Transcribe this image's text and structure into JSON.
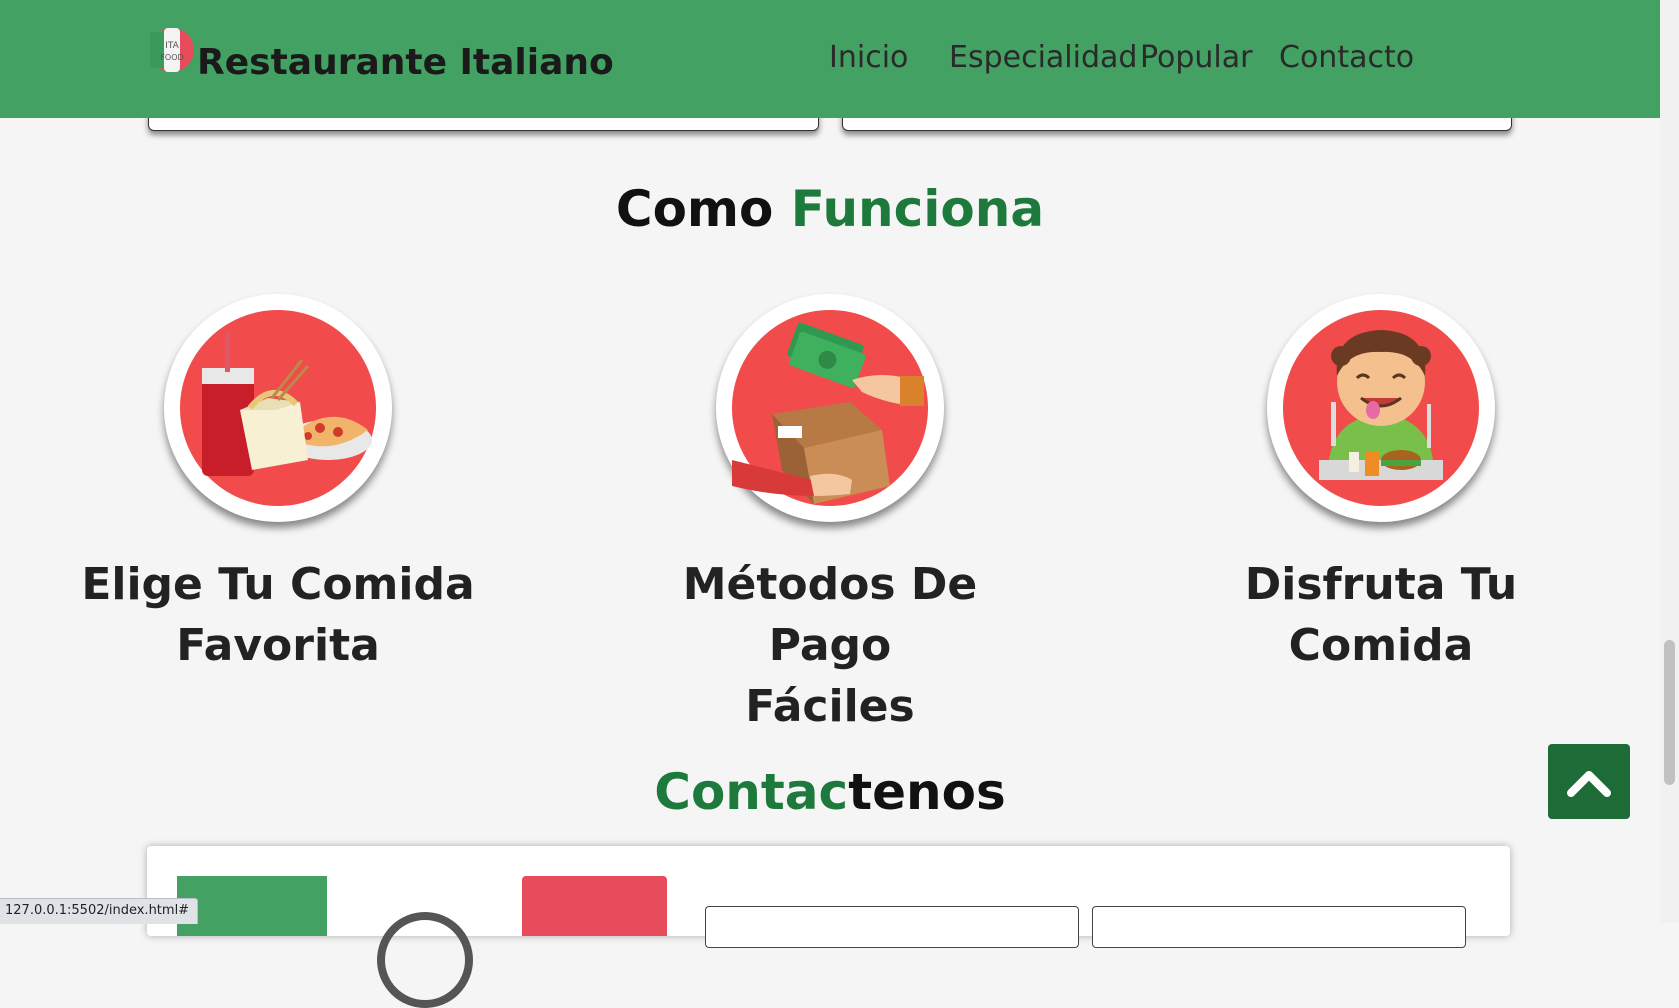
{
  "header": {
    "brand": "Restaurante Italiano",
    "logo_icon": "italian-food-logo",
    "nav": [
      "Inicio",
      "Especialidad",
      "Popular",
      "Contacto"
    ]
  },
  "how_it_works": {
    "title_part1": "Como ",
    "title_part2": "Funciona",
    "steps": [
      {
        "line1": "Elige Tu Comida",
        "line2": "Favorita",
        "icon": "food-combo-icon"
      },
      {
        "line1": "Métodos De Pago",
        "line2": "Fáciles",
        "icon": "payment-delivery-icon"
      },
      {
        "line1": "Disfruta Tu Comida",
        "line2": "",
        "icon": "happy-eater-icon"
      }
    ]
  },
  "contact": {
    "title_part1": "Contac",
    "title_part2": "tenos"
  },
  "status_url": "127.0.0.1:5502/index.html#",
  "colors": {
    "header_green": "#43a163",
    "accent_green": "#1e7a3c",
    "scroll_button": "#1d6b36",
    "circle_red": "#f24b4b"
  }
}
